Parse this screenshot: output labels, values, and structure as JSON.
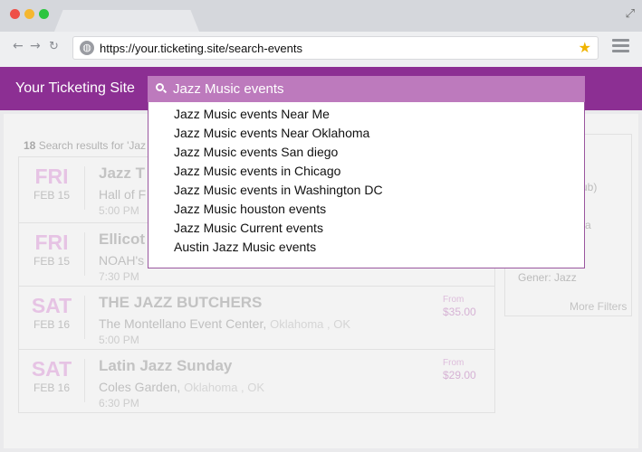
{
  "browser": {
    "url": "https://your.ticketing.site/search-events",
    "icons": {
      "back": "arrow-left",
      "forward": "arrow-right",
      "reload": "reload",
      "site": "globe",
      "bookmark": "star",
      "menu": "hamburger",
      "window": "expand"
    }
  },
  "header": {
    "site_title": "Your Ticketing Site",
    "search_value": "Jazz Music events"
  },
  "suggestions": [
    "Jazz Music events Near Me",
    "Jazz Music events Near Oklahoma",
    "Jazz Music events San diego",
    "Jazz Music events in Chicago",
    "Jazz Music events in Washington DC",
    "Jazz Music houston events",
    "Jazz Music Current events",
    "Austin Jazz Music events"
  ],
  "results": {
    "count": "18",
    "label_fragment": "Search results for 'Jaz",
    "events": [
      {
        "day": "FRI",
        "date": "FEB 15",
        "name": "Jazz T",
        "venue": "Hall of F",
        "city": "",
        "time": "5:00 PM",
        "from": "",
        "price": ""
      },
      {
        "day": "FRI",
        "date": "FEB 15",
        "name": "Ellicot",
        "venue": "NOAH's",
        "city": "",
        "time": "7:30 PM",
        "from": "",
        "price": ""
      },
      {
        "day": "SAT",
        "date": "FEB 16",
        "name": "THE JAZZ BUTCHERS",
        "venue": "The Montellano Event Center,",
        "city": "Oklahoma , OK",
        "time": "5:00 PM",
        "from": "From",
        "price": "$35.00"
      },
      {
        "day": "SAT",
        "date": "FEB 16",
        "name": "Latin Jazz Sunday",
        "venue": "Coles Garden,",
        "city": "Oklahoma , OK",
        "time": "6:30 PM",
        "from": "From",
        "price": "$29.00"
      }
    ]
  },
  "filters": {
    "fragments": [
      "ub)",
      "a",
      "Gener: Jazz"
    ],
    "more_label": "More Filters"
  }
}
